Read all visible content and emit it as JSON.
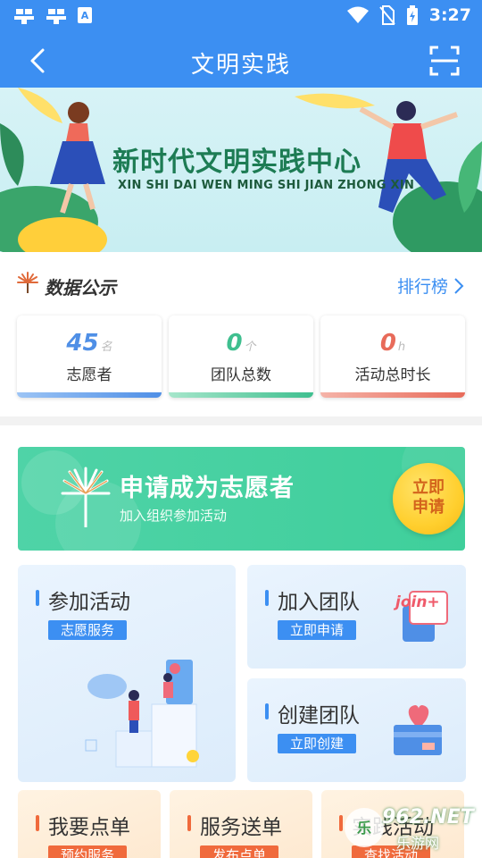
{
  "status_bar": {
    "time": "3:27"
  },
  "header": {
    "title": "文明实践"
  },
  "banner": {
    "title": "新时代文明实践中心",
    "subtitle": "XIN SHI DAI WEN MING SHI JIAN ZHONG XIN"
  },
  "data_section": {
    "title": "数据公示",
    "ranking_link": "排行榜",
    "stats": [
      {
        "value": "45",
        "unit": "名",
        "label": "志愿者",
        "color": "#4f8fe6"
      },
      {
        "value": "0",
        "unit": "个",
        "label": "团队总数",
        "color": "#3fbf8f"
      },
      {
        "value": "0",
        "unit": "h",
        "label": "活动总时长",
        "color": "#e86b5a"
      }
    ]
  },
  "apply": {
    "title": "申请成为志愿者",
    "subtitle": "加入组织参加活动",
    "button": "立即申请"
  },
  "cards": {
    "join_activity": {
      "title": "参加活动",
      "tag": "志愿服务"
    },
    "join_team": {
      "title": "加入团队",
      "tag": "立即申请",
      "badge": "join+"
    },
    "create_team": {
      "title": "创建团队",
      "tag": "立即创建"
    }
  },
  "bottom_cards": [
    {
      "title": "我要点单",
      "tag": "预约服务"
    },
    {
      "title": "服务送单",
      "tag": "发布点单"
    },
    {
      "title": "实践活动",
      "tag": "查找活动"
    }
  ],
  "watermark": {
    "brand": "962.NET",
    "sub": "乐游网"
  }
}
